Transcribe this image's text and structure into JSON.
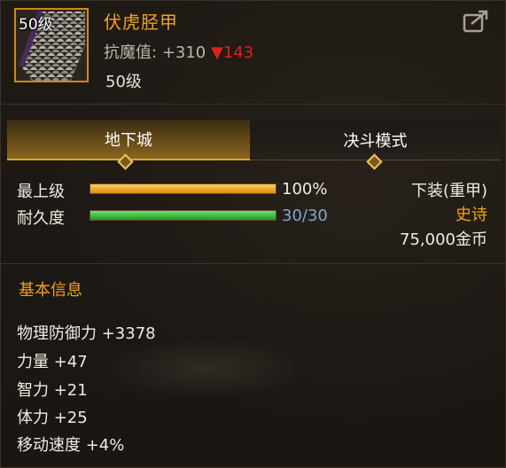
{
  "item": {
    "level_badge": "50级",
    "name": "伏虎胫甲",
    "resist_label": "抗魔值:",
    "resist_value": "+310",
    "resist_diff": "▼143",
    "required_level": "50级",
    "icon": "leg-armor-icon"
  },
  "tabs": [
    {
      "label": "地下城",
      "active": true
    },
    {
      "label": "决斗模式",
      "active": false
    }
  ],
  "stats": {
    "upgrade": {
      "label": "最上级",
      "value": "100%",
      "fraction": 1.0,
      "color": "#f0a21c"
    },
    "durability": {
      "label": "耐久度",
      "value": "30/30",
      "fraction": 1.0,
      "color": "#2fc02f"
    }
  },
  "info": {
    "slot": "下装(重甲)",
    "rarity": "史诗",
    "rarity_color": "#f0a21c",
    "price": "75,000金币"
  },
  "basic": {
    "title": "基本信息",
    "attributes": [
      "物理防御力 +3378",
      "力量 +47",
      "智力 +21",
      "体力 +25",
      "移动速度 +4%"
    ]
  }
}
